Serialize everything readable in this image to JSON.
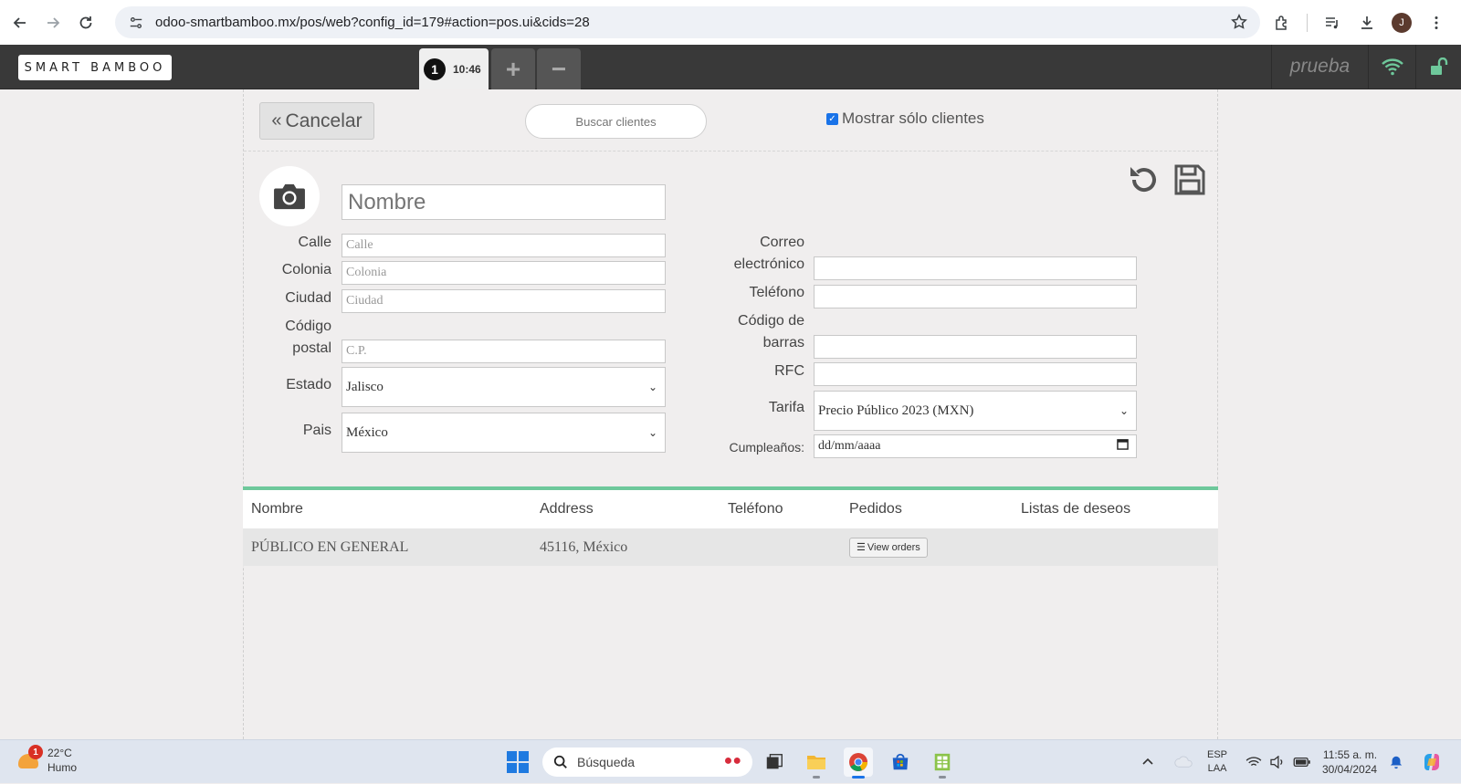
{
  "browser": {
    "url": "odoo-smartbamboo.mx/pos/web?config_id=179#action=pos.ui&cids=28",
    "profile_initial": "J"
  },
  "pos_header": {
    "logo_text": "SMART BAMBOO",
    "order_number": "1",
    "order_time": "10:46",
    "add_label": "+",
    "remove_label": "−",
    "user_name": "prueba",
    "accent_color": "#6ec89b"
  },
  "client_screen": {
    "cancel_label": "Cancelar",
    "search_placeholder": "Buscar clientes",
    "show_only_clients_label": "Mostrar sólo clientes",
    "show_only_clients_checked": true,
    "form": {
      "name_placeholder": "Nombre",
      "street_label": "Calle",
      "street_placeholder": "Calle",
      "colony_label": "Colonia",
      "colony_placeholder": "Colonia",
      "city_label": "Ciudad",
      "city_placeholder": "Ciudad",
      "zip_label_1": "Código",
      "zip_label_2": "postal",
      "zip_placeholder": "C.P.",
      "state_label": "Estado",
      "state_value": "Jalisco",
      "country_label": "Pais",
      "country_value": "México",
      "email_label_1": "Correo",
      "email_label_2": "electrónico",
      "phone_label": "Teléfono",
      "barcode_label_1": "Código de",
      "barcode_label_2": "barras",
      "rfc_label": "RFC",
      "pricelist_label": "Tarifa",
      "pricelist_value": "Precio Público 2023 (MXN)",
      "birthday_label": "Cumpleaños:",
      "birthday_placeholder": "dd/mm/aaaa"
    },
    "table": {
      "headers": [
        "Nombre",
        "Address",
        "Teléfono",
        "Pedidos",
        "Listas de deseos"
      ],
      "rows": [
        {
          "name": "PÚBLICO EN GENERAL",
          "address": "45116, México",
          "phone": "",
          "orders_button": "View orders",
          "wishlist": ""
        }
      ]
    }
  },
  "taskbar": {
    "weather_badge": "1",
    "temperature": "22°C",
    "weather_desc": "Humo",
    "search_label": "Búsqueda",
    "lang_1": "ESP",
    "lang_2": "LAA",
    "time": "11:55 a. m.",
    "date": "30/04/2024"
  }
}
